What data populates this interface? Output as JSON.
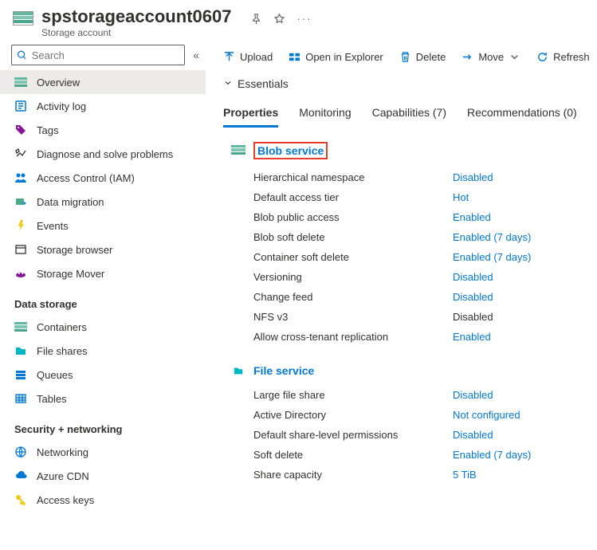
{
  "header": {
    "title": "spstorageaccount0607",
    "subtitle": "Storage account"
  },
  "search": {
    "placeholder": "Search"
  },
  "nav": {
    "items_top": [
      {
        "label": "Overview",
        "icon": "overview",
        "selected": true
      },
      {
        "label": "Activity log",
        "icon": "activity"
      },
      {
        "label": "Tags",
        "icon": "tags"
      },
      {
        "label": "Diagnose and solve problems",
        "icon": "diagnose"
      },
      {
        "label": "Access Control (IAM)",
        "icon": "iam"
      },
      {
        "label": "Data migration",
        "icon": "migration"
      },
      {
        "label": "Events",
        "icon": "events"
      },
      {
        "label": "Storage browser",
        "icon": "browser"
      },
      {
        "label": "Storage Mover",
        "icon": "mover"
      }
    ],
    "section_storage": "Data storage",
    "items_storage": [
      {
        "label": "Containers",
        "icon": "containers"
      },
      {
        "label": "File shares",
        "icon": "fileshares"
      },
      {
        "label": "Queues",
        "icon": "queues"
      },
      {
        "label": "Tables",
        "icon": "tables"
      }
    ],
    "section_security": "Security + networking",
    "items_security": [
      {
        "label": "Networking",
        "icon": "networking"
      },
      {
        "label": "Azure CDN",
        "icon": "cdn"
      },
      {
        "label": "Access keys",
        "icon": "keys"
      }
    ]
  },
  "toolbar": {
    "upload": "Upload",
    "explorer": "Open in Explorer",
    "delete": "Delete",
    "move": "Move",
    "refresh": "Refresh"
  },
  "essentials": {
    "label": "Essentials"
  },
  "tabs": [
    {
      "label": "Properties",
      "active": true
    },
    {
      "label": "Monitoring"
    },
    {
      "label": "Capabilities (7)"
    },
    {
      "label": "Recommendations (0)"
    }
  ],
  "sections": {
    "blob": {
      "title": "Blob service",
      "rows": [
        {
          "label": "Hierarchical namespace",
          "value": "Disabled",
          "link": true
        },
        {
          "label": "Default access tier",
          "value": "Hot",
          "link": true
        },
        {
          "label": "Blob public access",
          "value": "Enabled",
          "link": true
        },
        {
          "label": "Blob soft delete",
          "value": "Enabled (7 days)",
          "link": true
        },
        {
          "label": "Container soft delete",
          "value": "Enabled (7 days)",
          "link": true
        },
        {
          "label": "Versioning",
          "value": "Disabled",
          "link": true
        },
        {
          "label": "Change feed",
          "value": "Disabled",
          "link": true
        },
        {
          "label": "NFS v3",
          "value": "Disabled",
          "link": false
        },
        {
          "label": "Allow cross-tenant replication",
          "value": "Enabled",
          "link": true
        }
      ]
    },
    "file": {
      "title": "File service",
      "rows": [
        {
          "label": "Large file share",
          "value": "Disabled",
          "link": true
        },
        {
          "label": "Active Directory",
          "value": "Not configured",
          "link": true
        },
        {
          "label": "Default share-level permissions",
          "value": "Disabled",
          "link": true
        },
        {
          "label": "Soft delete",
          "value": "Enabled (7 days)",
          "link": true
        },
        {
          "label": "Share capacity",
          "value": "5 TiB",
          "link": true
        }
      ]
    }
  }
}
